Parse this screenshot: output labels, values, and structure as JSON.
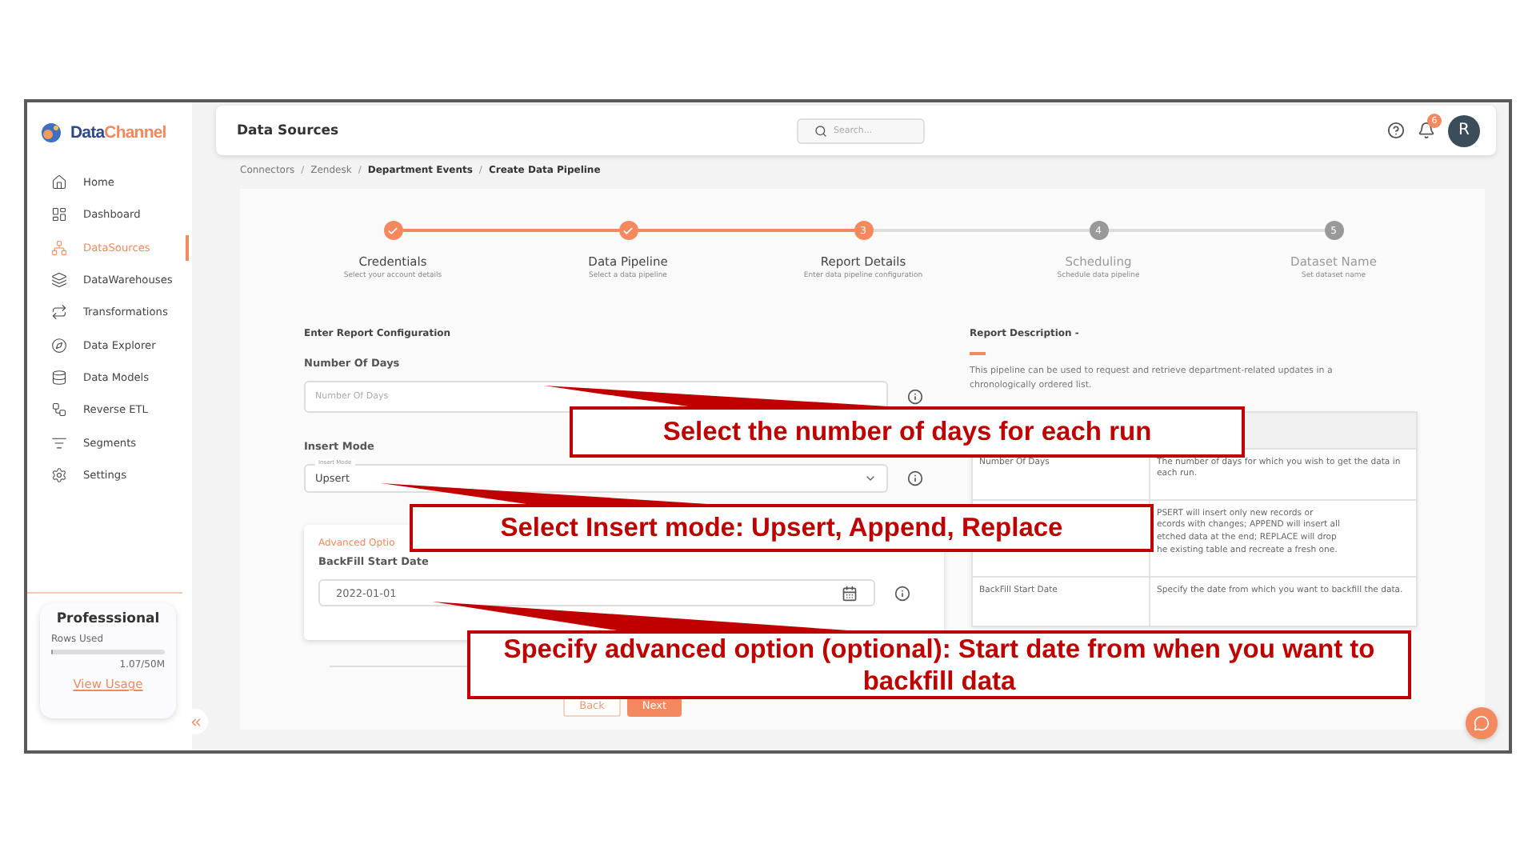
{
  "logo": {
    "first": "Data",
    "second": "Channel"
  },
  "sidebar": {
    "items": [
      {
        "label": "Home",
        "selected": false
      },
      {
        "label": "Dashboard",
        "selected": false
      },
      {
        "label": "DataSources",
        "selected": true
      },
      {
        "label": "DataWarehouses",
        "selected": false
      },
      {
        "label": "Transformations",
        "selected": false
      },
      {
        "label": "Data Explorer",
        "selected": false
      },
      {
        "label": "Data Models",
        "selected": false
      },
      {
        "label": "Reverse ETL",
        "selected": false
      },
      {
        "label": "Segments",
        "selected": false
      },
      {
        "label": "Settings",
        "selected": false
      }
    ],
    "plan": {
      "name": "Professsional",
      "rows_label": "Rows Used",
      "level": 0.02,
      "reading": "1.07/50M",
      "link": "View Usage"
    }
  },
  "header": {
    "title": "Data Sources",
    "search_placeholder": "Search...",
    "notifications": "6",
    "avatar": "R"
  },
  "breadcrumb": [
    {
      "label": "Connectors",
      "bold": false
    },
    {
      "separator": "/",
      "label": "Zendesk",
      "bold": false
    },
    {
      "separator": "/",
      "label": "Department Events",
      "bold": true
    },
    {
      "separator": "/",
      "label": "Create Data Pipeline",
      "bold": true
    }
  ],
  "steps": [
    {
      "done": true,
      "reached": true,
      "title": "Credentials",
      "subtitle": "Select your account details"
    },
    {
      "done": true,
      "reached": true,
      "title": "Data Pipeline",
      "subtitle": "Select a data pipeline"
    },
    {
      "done": false,
      "reached": true,
      "number": "3",
      "title": "Report Details",
      "subtitle": "Enter data pipeline configuration"
    },
    {
      "done": false,
      "reached": false,
      "number": "4",
      "title": "Scheduling",
      "subtitle": "Schedule data pipeline"
    },
    {
      "done": false,
      "reached": false,
      "number": "5",
      "title": "Dataset Name",
      "subtitle": "Set dataset name"
    }
  ],
  "form": {
    "heading": "Enter Report Configuration",
    "days": {
      "label": "Number Of Days",
      "placeholder": "Number Of Days"
    },
    "insert_mode": {
      "label": "Insert Mode",
      "floating_label": "Insert Mode",
      "value": "Upsert"
    },
    "advanced": {
      "title": "Advanced Optio",
      "label": "BackFill Start Date",
      "value": "2022-01-01"
    },
    "buttons": [
      {
        "label": "Back",
        "kind": "secondary"
      },
      {
        "label": "Next",
        "kind": "primary"
      }
    ]
  },
  "description": {
    "title": "Report Description -",
    "text": "This pipeline can be used to request and retrieve department-related updates in a chronologically ordered list.",
    "rows": [
      {
        "parameter": "Number Of Days",
        "text": "The number of days for which you wish to get the data in each run."
      },
      {
        "text": "PSERT will insert only new records or\necords with changes; APPEND will insert all\netched data at the end; REPLACE will drop\nhe existing table and recreate a fresh one."
      },
      {
        "parameter": "BackFill Start Date",
        "text": "Specify the date from which you want to backfill the data."
      }
    ]
  },
  "callouts": [
    {
      "text": "Select the number of days for each run"
    },
    {
      "text": "Select Insert mode: Upsert, Append, Replace"
    },
    {
      "text": "Specify advanced option (optional): Start date from when you want to backfill data"
    }
  ]
}
